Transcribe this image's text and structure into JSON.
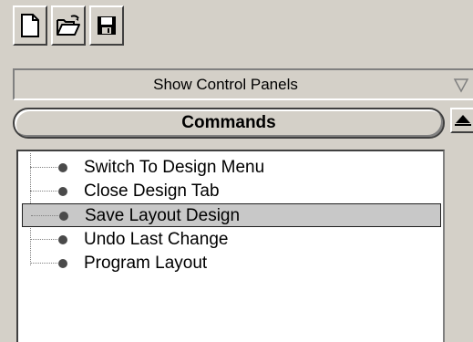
{
  "toolbar": {
    "buttons": [
      {
        "name": "new-button",
        "icon": "new-document-icon"
      },
      {
        "name": "open-button",
        "icon": "open-folder-icon"
      },
      {
        "name": "save-button",
        "icon": "floppy-disk-icon"
      }
    ]
  },
  "control_panels_dropdown": {
    "label": "Show Control Panels",
    "arrow_icon": "triangle-down-icon"
  },
  "commands_panel": {
    "title": "Commands",
    "items": [
      {
        "label": "Switch To Design Menu",
        "selected": false
      },
      {
        "label": "Close Design Tab",
        "selected": false
      },
      {
        "label": "Save Layout Design",
        "selected": true
      },
      {
        "label": "Undo Last Change",
        "selected": false
      },
      {
        "label": "Program Layout",
        "selected": false
      }
    ]
  },
  "scrollbar": {
    "up_icon": "scroll-up-arrow-icon"
  },
  "colors": {
    "face": "#d4d0c8",
    "selection": "#c8c8c8",
    "bullet": "#4a4a4a"
  }
}
